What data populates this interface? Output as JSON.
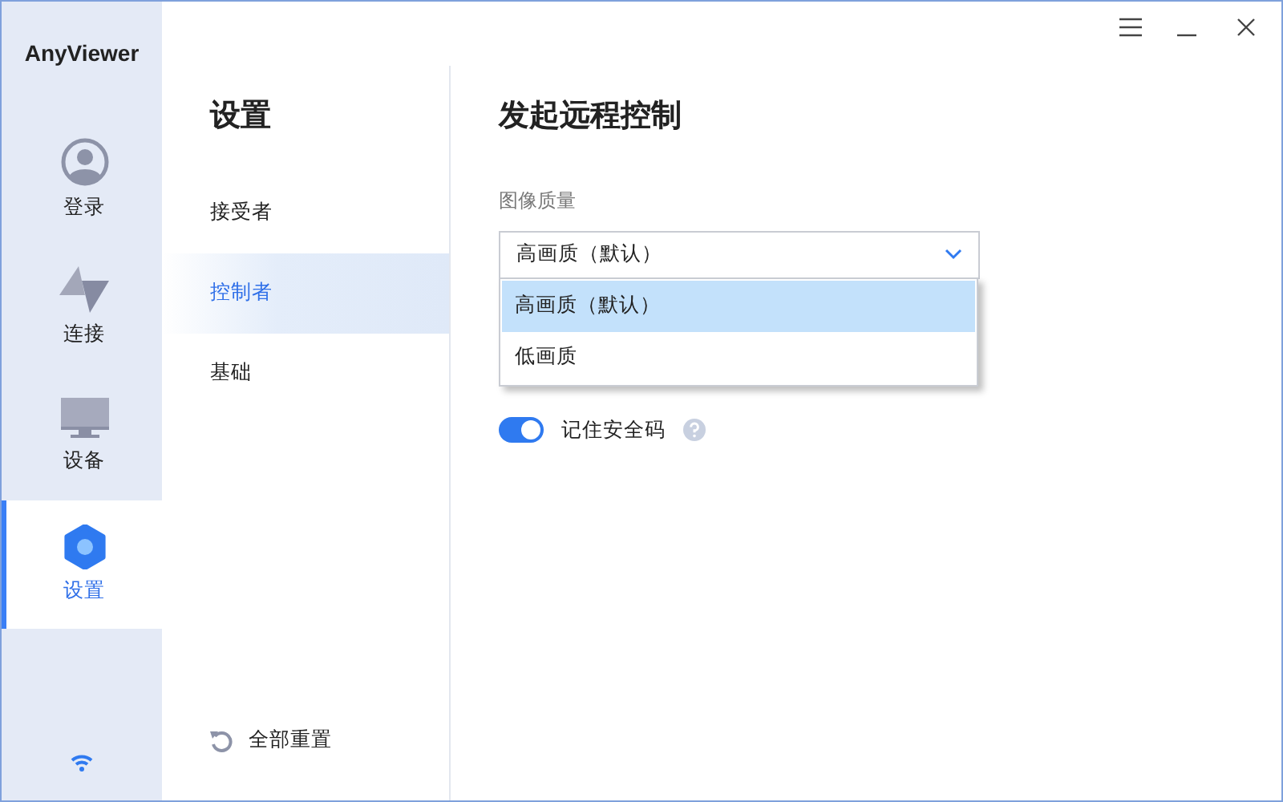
{
  "app_name": "AnyViewer",
  "rail": {
    "items": [
      {
        "kind": "account",
        "label": "登录",
        "selected": false
      },
      {
        "kind": "connect",
        "label": "连接",
        "selected": false
      },
      {
        "kind": "device",
        "label": "设备",
        "selected": false
      },
      {
        "kind": "settings",
        "label": "设置",
        "selected": true
      }
    ]
  },
  "settings_nav": {
    "title": "设置",
    "items": [
      {
        "label": "接受者",
        "selected": false
      },
      {
        "label": "控制者",
        "selected": true
      },
      {
        "label": "基础",
        "selected": false
      }
    ],
    "reset_label": "全部重置"
  },
  "main": {
    "title": "发起远程控制",
    "image_quality": {
      "label": "图像质量",
      "value": "高画质（默认）",
      "expanded": true,
      "options": [
        {
          "label": "高画质（默认）",
          "selected": true
        },
        {
          "label": "低画质",
          "selected": false
        }
      ]
    },
    "remember_code": {
      "label": "记住安全码",
      "on": true
    }
  }
}
